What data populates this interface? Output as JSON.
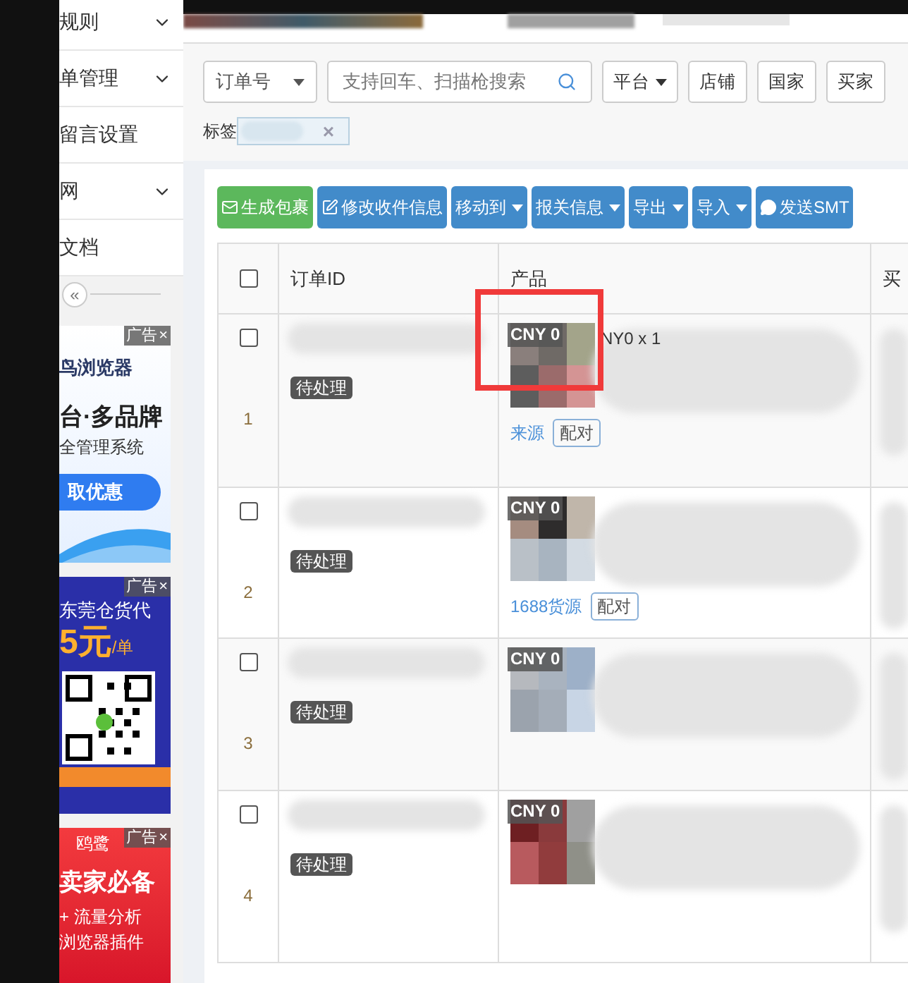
{
  "sidebar": {
    "items": [
      {
        "label": "规则",
        "expandable": true
      },
      {
        "label": "单管理",
        "expandable": true
      },
      {
        "label": "留言设置",
        "expandable": false
      },
      {
        "label": "网",
        "expandable": true
      },
      {
        "label": "文档",
        "expandable": false
      }
    ],
    "collapse_button": "«"
  },
  "ads": [
    {
      "kind": "browser",
      "badge": "广告",
      "close": "×",
      "lines": [
        "鸟浏览器",
        "台·多品牌",
        "全管理系统",
        "取优惠"
      ]
    },
    {
      "kind": "forwarder",
      "badge": "广告",
      "close": "×",
      "lines": [
        "东莞仓货代",
        "5元",
        "/单"
      ]
    },
    {
      "kind": "plugin",
      "badge": "广告",
      "close": "×",
      "lines": [
        "鸥鹭",
        "卖家必备",
        "+ 流量分析",
        "浏览器插件"
      ]
    }
  ],
  "filters": {
    "search_type": "订单号",
    "search": {
      "placeholder": "支持回车、扫描枪搜索"
    },
    "buttons": [
      {
        "label": "平台",
        "dropdown": true
      },
      {
        "label": "店铺",
        "dropdown": false
      },
      {
        "label": "国家",
        "dropdown": false
      },
      {
        "label": "买家",
        "dropdown": false
      }
    ],
    "tag_label": "标签",
    "tag_remove": "×"
  },
  "toolbar": [
    {
      "label": "生成包裹",
      "kind": "success",
      "dropdown": false
    },
    {
      "label": "修改收件信息",
      "kind": "primary",
      "dropdown": false
    },
    {
      "label": "移动到",
      "kind": "primary",
      "dropdown": true
    },
    {
      "label": "报关信息",
      "kind": "primary",
      "dropdown": true
    },
    {
      "label": "导出",
      "kind": "primary",
      "dropdown": true
    },
    {
      "label": "导入",
      "kind": "primary",
      "dropdown": true
    },
    {
      "label": "发送SMT",
      "kind": "primary",
      "dropdown": false
    }
  ],
  "table": {
    "columns": [
      "订单ID",
      "产品",
      "买"
    ],
    "select_all_checked": false,
    "rows": [
      {
        "index": "1",
        "checked": false,
        "status": "待处理",
        "price": "CNY 0",
        "quantity": "NY0 x 1",
        "source": "来源",
        "pair": "配对"
      },
      {
        "index": "2",
        "checked": false,
        "status": "待处理",
        "price": "CNY 0",
        "source": "1688货源",
        "pair": "配对"
      },
      {
        "index": "3",
        "checked": false,
        "status": "待处理",
        "price": "CNY 0"
      },
      {
        "index": "4",
        "checked": false,
        "status": "待处理",
        "price": "CNY 0"
      }
    ]
  }
}
